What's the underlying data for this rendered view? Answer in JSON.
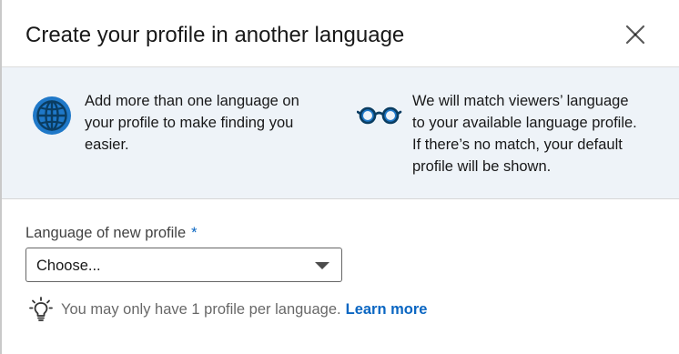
{
  "dialog": {
    "title": "Create your profile in another language",
    "close_icon": "close-icon"
  },
  "info": {
    "left": {
      "icon": "globe-icon",
      "lines": [
        "Add more than one language on",
        "your profile to make finding you",
        "easier."
      ]
    },
    "right": {
      "icon": "glasses-icon",
      "lines": [
        "We will match viewers’ language",
        "to your available language profile.",
        "If there’s no match, your default",
        "profile will be shown."
      ]
    }
  },
  "form": {
    "label": "Language of new profile",
    "required_marker": "*",
    "select": {
      "selected": "Choose..."
    },
    "hint": {
      "icon": "lightbulb-icon",
      "text": "You may only have 1 profile per language.",
      "link": "Learn more"
    }
  },
  "colors": {
    "accent": "#0a66c2",
    "info_background": "#eef3f8",
    "icon_navy": "#0a3d62",
    "icon_blue": "#1f78c8"
  }
}
